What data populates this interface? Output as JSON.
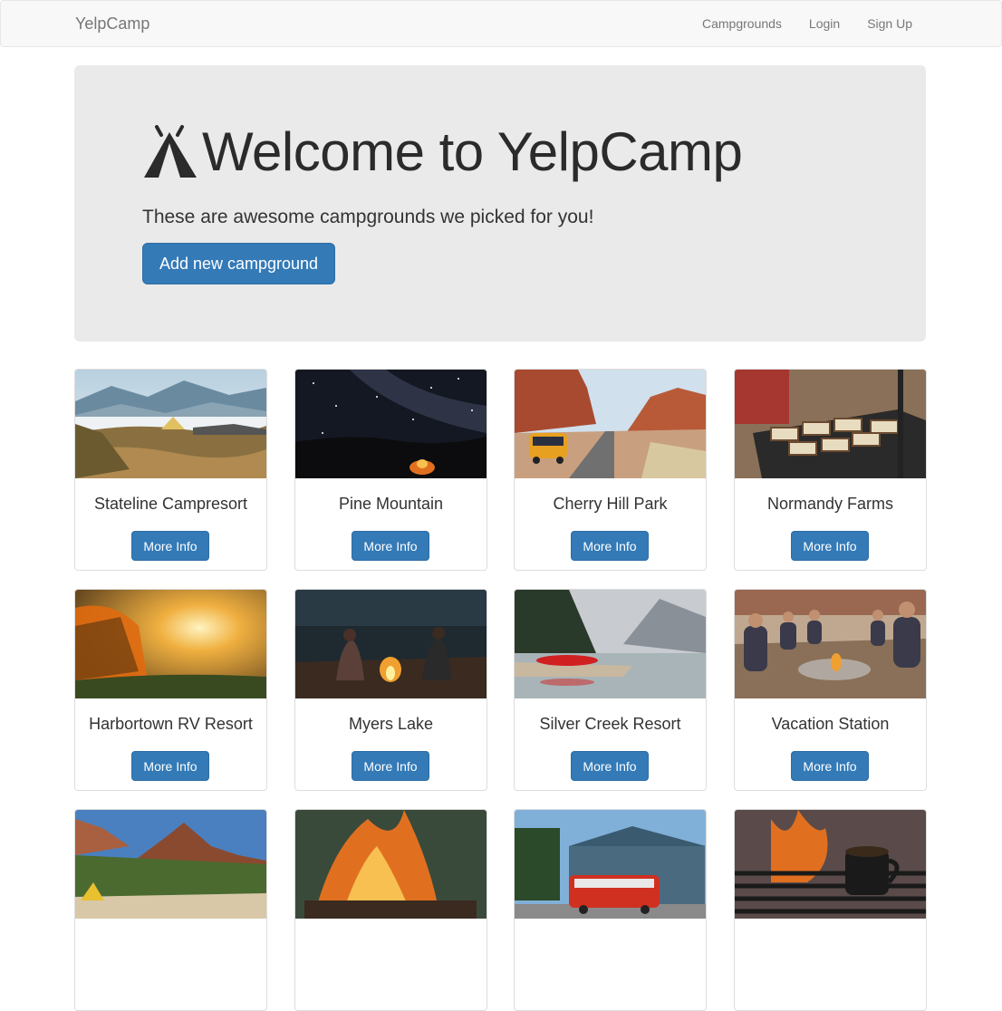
{
  "navbar": {
    "brand": "YelpCamp",
    "links": [
      "Campgrounds",
      "Login",
      "Sign Up"
    ]
  },
  "jumbotron": {
    "title": "Welcome to YelpCamp",
    "subtitle": "These are awesome campgrounds we picked for you!",
    "button": "Add new campground",
    "icon": "tent-icon"
  },
  "campgrounds": [
    {
      "name": "Stateline Campresort",
      "button": "More Info",
      "image": "mountain-tent-image"
    },
    {
      "name": "Pine Mountain",
      "button": "More Info",
      "image": "milky-way-night-image"
    },
    {
      "name": "Cherry Hill Park",
      "button": "More Info",
      "image": "desert-van-road-image"
    },
    {
      "name": "Normandy Farms",
      "button": "More Info",
      "image": "grill-sandwiches-image"
    },
    {
      "name": "Harbortown RV Resort",
      "button": "More Info",
      "image": "sunset-tent-image"
    },
    {
      "name": "Myers Lake",
      "button": "More Info",
      "image": "campfire-couple-image"
    },
    {
      "name": "Silver Creek Resort",
      "button": "More Info",
      "image": "lake-kayak-image"
    },
    {
      "name": "Vacation Station",
      "button": "More Info",
      "image": "group-campfire-image"
    },
    {
      "name": "",
      "button": "",
      "image": "canyon-tent-image"
    },
    {
      "name": "",
      "button": "",
      "image": "fire-closeup-image"
    },
    {
      "name": "",
      "button": "",
      "image": "red-van-house-image"
    },
    {
      "name": "",
      "button": "",
      "image": "coffee-grill-image"
    }
  ],
  "colors": {
    "primary": "#337ab7",
    "navbar_bg": "#f8f8f8",
    "jumbotron_bg": "#eaeaea"
  }
}
